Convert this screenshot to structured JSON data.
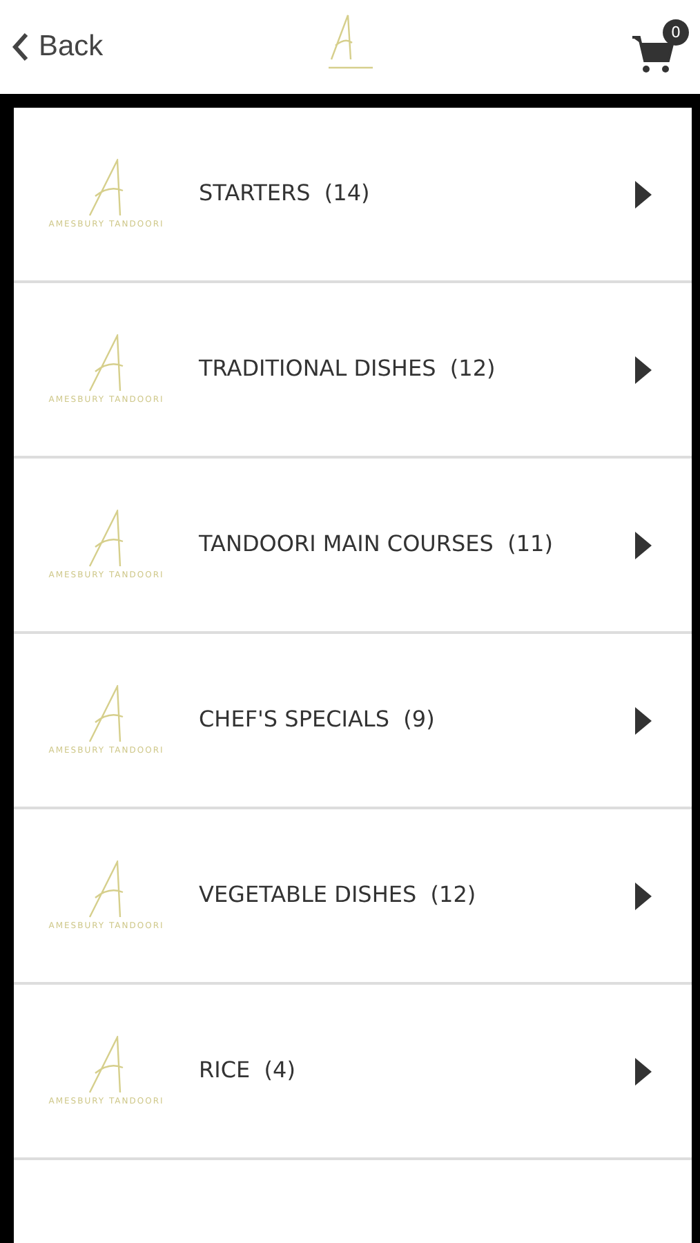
{
  "header": {
    "back_label": "Back",
    "cart_count": "0"
  },
  "categories": [
    {
      "name": "STARTERS",
      "count": "(14)",
      "logo_text": "AMESBURY TANDOORI"
    },
    {
      "name": "TRADITIONAL DISHES",
      "count": "(12)",
      "logo_text": "AMESBURY TANDOORI"
    },
    {
      "name": "TANDOORI MAIN COURSES",
      "count": "(11)",
      "logo_text": "AMESBURY TANDOORI"
    },
    {
      "name": "CHEF'S SPECIALS",
      "count": "(9)",
      "logo_text": "AMESBURY TANDOORI"
    },
    {
      "name": "VEGETABLE DISHES",
      "count": "(12)",
      "logo_text": "AMESBURY TANDOORI"
    },
    {
      "name": "RICE",
      "count": "(4)",
      "logo_text": "AMESBURY TANDOORI"
    }
  ],
  "more_below": true
}
